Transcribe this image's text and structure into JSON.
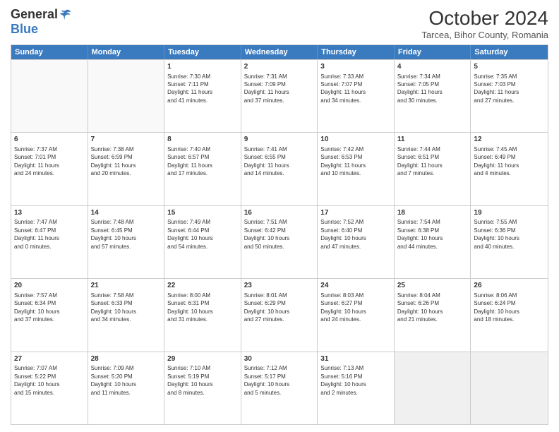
{
  "header": {
    "logo_general": "General",
    "logo_blue": "Blue",
    "title": "October 2024",
    "location": "Tarcea, Bihor County, Romania"
  },
  "days_of_week": [
    "Sunday",
    "Monday",
    "Tuesday",
    "Wednesday",
    "Thursday",
    "Friday",
    "Saturday"
  ],
  "weeks": [
    [
      {
        "day": "",
        "text": ""
      },
      {
        "day": "",
        "text": ""
      },
      {
        "day": "1",
        "text": "Sunrise: 7:30 AM\nSunset: 7:11 PM\nDaylight: 11 hours\nand 41 minutes."
      },
      {
        "day": "2",
        "text": "Sunrise: 7:31 AM\nSunset: 7:09 PM\nDaylight: 11 hours\nand 37 minutes."
      },
      {
        "day": "3",
        "text": "Sunrise: 7:33 AM\nSunset: 7:07 PM\nDaylight: 11 hours\nand 34 minutes."
      },
      {
        "day": "4",
        "text": "Sunrise: 7:34 AM\nSunset: 7:05 PM\nDaylight: 11 hours\nand 30 minutes."
      },
      {
        "day": "5",
        "text": "Sunrise: 7:35 AM\nSunset: 7:03 PM\nDaylight: 11 hours\nand 27 minutes."
      }
    ],
    [
      {
        "day": "6",
        "text": "Sunrise: 7:37 AM\nSunset: 7:01 PM\nDaylight: 11 hours\nand 24 minutes."
      },
      {
        "day": "7",
        "text": "Sunrise: 7:38 AM\nSunset: 6:59 PM\nDaylight: 11 hours\nand 20 minutes."
      },
      {
        "day": "8",
        "text": "Sunrise: 7:40 AM\nSunset: 6:57 PM\nDaylight: 11 hours\nand 17 minutes."
      },
      {
        "day": "9",
        "text": "Sunrise: 7:41 AM\nSunset: 6:55 PM\nDaylight: 11 hours\nand 14 minutes."
      },
      {
        "day": "10",
        "text": "Sunrise: 7:42 AM\nSunset: 6:53 PM\nDaylight: 11 hours\nand 10 minutes."
      },
      {
        "day": "11",
        "text": "Sunrise: 7:44 AM\nSunset: 6:51 PM\nDaylight: 11 hours\nand 7 minutes."
      },
      {
        "day": "12",
        "text": "Sunrise: 7:45 AM\nSunset: 6:49 PM\nDaylight: 11 hours\nand 4 minutes."
      }
    ],
    [
      {
        "day": "13",
        "text": "Sunrise: 7:47 AM\nSunset: 6:47 PM\nDaylight: 11 hours\nand 0 minutes."
      },
      {
        "day": "14",
        "text": "Sunrise: 7:48 AM\nSunset: 6:45 PM\nDaylight: 10 hours\nand 57 minutes."
      },
      {
        "day": "15",
        "text": "Sunrise: 7:49 AM\nSunset: 6:44 PM\nDaylight: 10 hours\nand 54 minutes."
      },
      {
        "day": "16",
        "text": "Sunrise: 7:51 AM\nSunset: 6:42 PM\nDaylight: 10 hours\nand 50 minutes."
      },
      {
        "day": "17",
        "text": "Sunrise: 7:52 AM\nSunset: 6:40 PM\nDaylight: 10 hours\nand 47 minutes."
      },
      {
        "day": "18",
        "text": "Sunrise: 7:54 AM\nSunset: 6:38 PM\nDaylight: 10 hours\nand 44 minutes."
      },
      {
        "day": "19",
        "text": "Sunrise: 7:55 AM\nSunset: 6:36 PM\nDaylight: 10 hours\nand 40 minutes."
      }
    ],
    [
      {
        "day": "20",
        "text": "Sunrise: 7:57 AM\nSunset: 6:34 PM\nDaylight: 10 hours\nand 37 minutes."
      },
      {
        "day": "21",
        "text": "Sunrise: 7:58 AM\nSunset: 6:33 PM\nDaylight: 10 hours\nand 34 minutes."
      },
      {
        "day": "22",
        "text": "Sunrise: 8:00 AM\nSunset: 6:31 PM\nDaylight: 10 hours\nand 31 minutes."
      },
      {
        "day": "23",
        "text": "Sunrise: 8:01 AM\nSunset: 6:29 PM\nDaylight: 10 hours\nand 27 minutes."
      },
      {
        "day": "24",
        "text": "Sunrise: 8:03 AM\nSunset: 6:27 PM\nDaylight: 10 hours\nand 24 minutes."
      },
      {
        "day": "25",
        "text": "Sunrise: 8:04 AM\nSunset: 6:26 PM\nDaylight: 10 hours\nand 21 minutes."
      },
      {
        "day": "26",
        "text": "Sunrise: 8:06 AM\nSunset: 6:24 PM\nDaylight: 10 hours\nand 18 minutes."
      }
    ],
    [
      {
        "day": "27",
        "text": "Sunrise: 7:07 AM\nSunset: 5:22 PM\nDaylight: 10 hours\nand 15 minutes."
      },
      {
        "day": "28",
        "text": "Sunrise: 7:09 AM\nSunset: 5:20 PM\nDaylight: 10 hours\nand 11 minutes."
      },
      {
        "day": "29",
        "text": "Sunrise: 7:10 AM\nSunset: 5:19 PM\nDaylight: 10 hours\nand 8 minutes."
      },
      {
        "day": "30",
        "text": "Sunrise: 7:12 AM\nSunset: 5:17 PM\nDaylight: 10 hours\nand 5 minutes."
      },
      {
        "day": "31",
        "text": "Sunrise: 7:13 AM\nSunset: 5:16 PM\nDaylight: 10 hours\nand 2 minutes."
      },
      {
        "day": "",
        "text": ""
      },
      {
        "day": "",
        "text": ""
      }
    ]
  ]
}
